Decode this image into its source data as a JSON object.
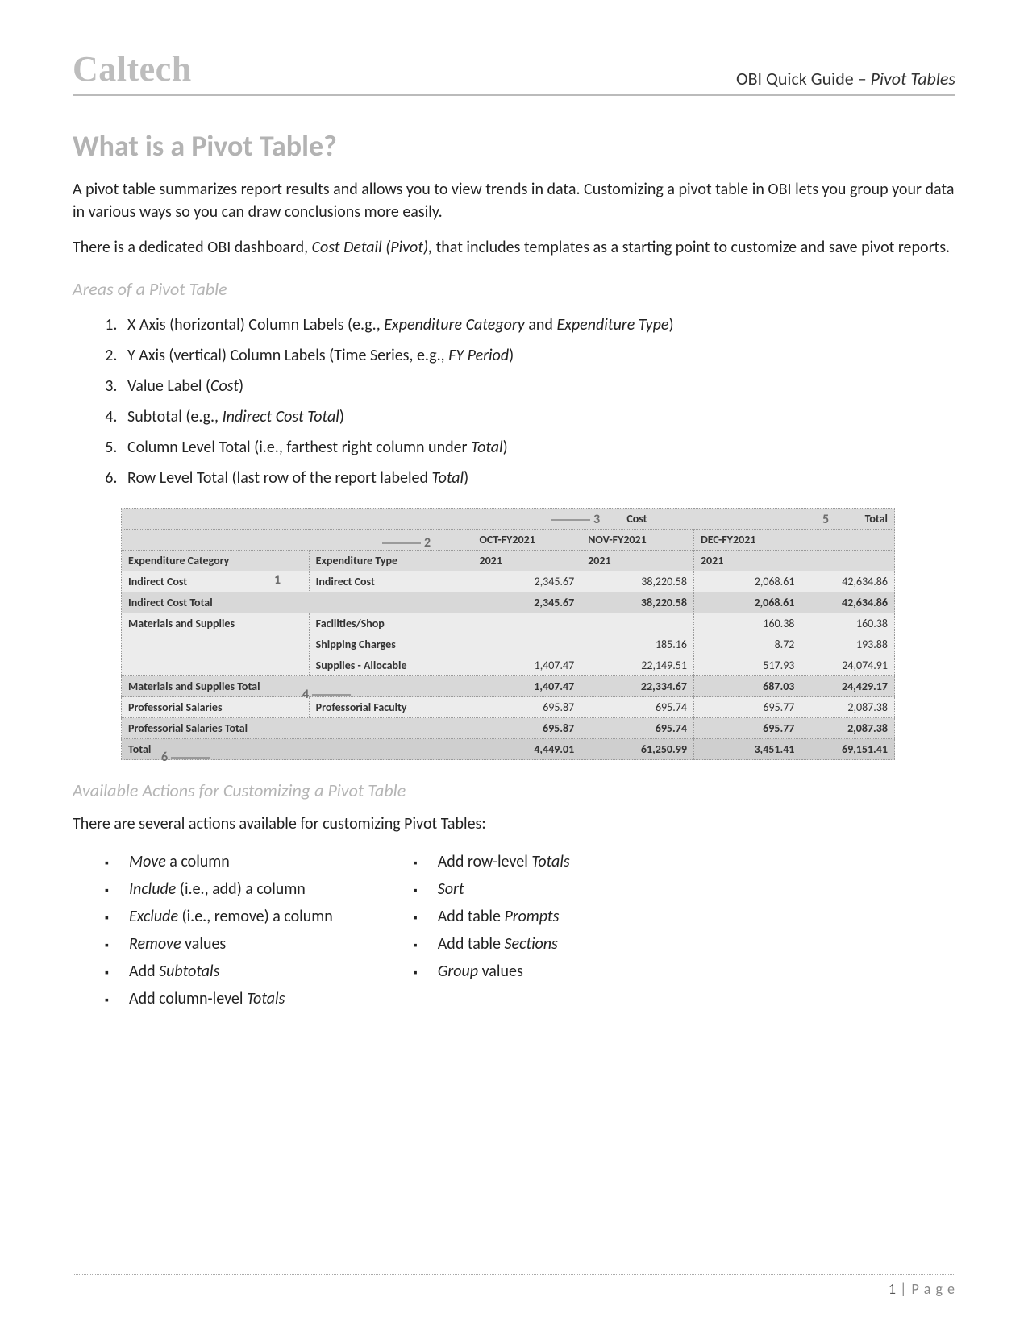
{
  "header": {
    "logo": "Caltech",
    "guide_prefix": "OBI Quick Guide – ",
    "guide_topic": "Pivot Tables"
  },
  "title": "What is a Pivot Table?",
  "intro_p1": "A pivot table summarizes report results and allows you to view trends in data. Customizing a pivot table in OBI lets you group your data in various ways so you can draw conclusions more easily.",
  "intro_p2_a": "There is a dedicated OBI dashboard, ",
  "intro_p2_i": "Cost Detail (Pivot),",
  "intro_p2_b": " that includes templates as a starting point to customize and save pivot reports.",
  "areas_heading": "Areas of a Pivot Table",
  "areas_items": [
    {
      "pre": "X Axis (horizontal) Column Labels (e.g., ",
      "it": "Expenditure Category",
      "mid": " and ",
      "it2": "Expenditure Type",
      "post": ")"
    },
    {
      "pre": "Y Axis (vertical) Column Labels (Time Series, e.g., ",
      "it": "FY Period",
      "post": ")"
    },
    {
      "pre": "Value Label (",
      "it": "Cost",
      "post": ")"
    },
    {
      "pre": "Subtotal (e.g., ",
      "it": "Indirect Cost Total",
      "post": ")"
    },
    {
      "pre": "Column Level Total (i.e., farthest right column under ",
      "it": "Total",
      "post": ")"
    },
    {
      "pre": "Row Level Total (last row of the report labeled ",
      "it": "Total",
      "post": ")"
    }
  ],
  "pivot": {
    "top_measure": "Cost",
    "top_total": "Total",
    "periods": [
      "OCT-FY2021",
      "NOV-FY2021",
      "DEC-FY2021"
    ],
    "year_row": [
      "2021",
      "2021",
      "2021"
    ],
    "col1_label": "Expenditure Category",
    "col2_label": "Expenditure Type",
    "rows": [
      {
        "cat": "Indirect Cost",
        "type": "Indirect Cost",
        "v": [
          "2,345.67",
          "38,220.58",
          "2,068.61",
          "42,634.86"
        ]
      },
      {
        "subtotal": true,
        "label": "Indirect Cost Total",
        "v": [
          "2,345.67",
          "38,220.58",
          "2,068.61",
          "42,634.86"
        ]
      },
      {
        "cat": "Materials and Supplies",
        "type": "Facilities/Shop",
        "v": [
          "",
          "",
          "160.38",
          "160.38"
        ]
      },
      {
        "cat": "",
        "type": "Shipping Charges",
        "v": [
          "",
          "185.16",
          "8.72",
          "193.88"
        ]
      },
      {
        "cat": "",
        "type": "Supplies - Allocable",
        "v": [
          "1,407.47",
          "22,149.51",
          "517.93",
          "24,074.91"
        ]
      },
      {
        "subtotal": true,
        "label": "Materials and Supplies Total",
        "v": [
          "1,407.47",
          "22,334.67",
          "687.03",
          "24,429.17"
        ]
      },
      {
        "cat": "Professorial Salaries",
        "type": "Professorial Faculty",
        "v": [
          "695.87",
          "695.74",
          "695.77",
          "2,087.38"
        ]
      },
      {
        "subtotal": true,
        "label": "Professorial Salaries Total",
        "v": [
          "695.87",
          "695.74",
          "695.77",
          "2,087.38"
        ]
      },
      {
        "grand": true,
        "label": "Total",
        "v": [
          "4,449.01",
          "61,250.99",
          "3,451.41",
          "69,151.41"
        ]
      }
    ],
    "callouts": {
      "1": "1",
      "2": "2",
      "3": "3",
      "4": "4",
      "5": "5",
      "6": "6"
    }
  },
  "actions_heading": "Available Actions for Customizing a Pivot Table",
  "actions_intro": "There are several actions available for customizing Pivot Tables:",
  "actions_left": [
    {
      "it": "Move",
      "post": " a column"
    },
    {
      "it": "Include",
      "post": " (i.e., add) a column"
    },
    {
      "it": "Exclude",
      "post": " (i.e., remove) a column"
    },
    {
      "it": "Remove",
      "post": " values"
    },
    {
      "pre": "Add ",
      "it": "Subtotals"
    },
    {
      "pre": "Add column-level ",
      "it": "Totals"
    }
  ],
  "actions_right": [
    {
      "pre": "Add row-level ",
      "it": "Totals"
    },
    {
      "it": "Sort"
    },
    {
      "pre": "Add table ",
      "it": "Prompts"
    },
    {
      "pre": "Add table ",
      "it": "Sections"
    },
    {
      "it": "Group",
      "post": " values"
    }
  ],
  "footer": {
    "page_num": "1",
    "page_word": " | P a g e"
  }
}
